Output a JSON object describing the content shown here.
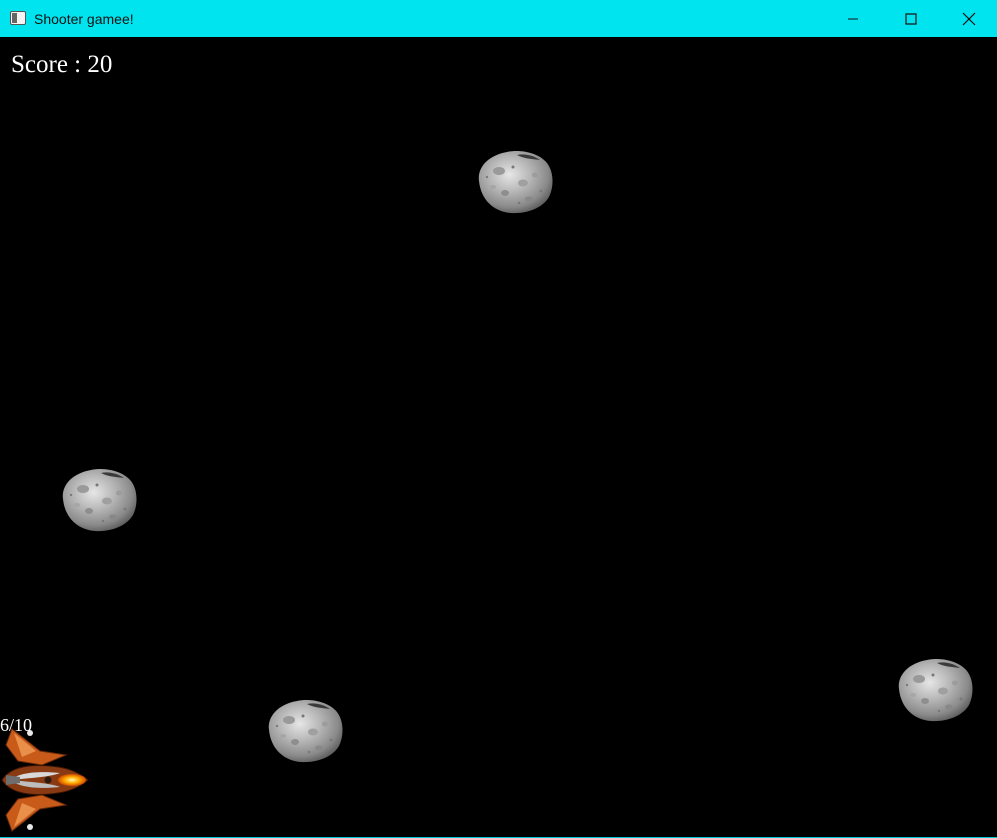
{
  "window": {
    "title": "Shooter gamee!",
    "titlebar_color": "#00e4f0",
    "controls": {
      "minimize_icon": "minimize-icon",
      "maximize_icon": "maximize-icon",
      "close_icon": "close-icon"
    }
  },
  "hud": {
    "score_text": "Score : 20",
    "ammo_text": "6/10"
  },
  "game": {
    "background_color": "#000000",
    "asteroid_count": 4,
    "asteroid_icon": "asteroid-icon",
    "player_icon": "spaceship-icon"
  }
}
